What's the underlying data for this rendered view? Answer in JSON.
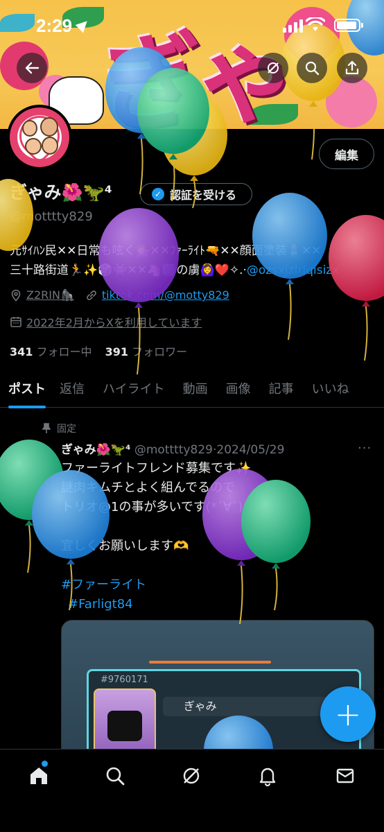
{
  "status_bar": {
    "time": "2:29"
  },
  "profile": {
    "banner_text": "ぎゃみ",
    "display_name": "ぎゃみ🌺🦖⁴",
    "handle": "@motttty829",
    "edit_label": "編集",
    "verify_label": "認証を受ける",
    "bio_line1": "元ｻｲﾊﾝ民✕✕日常も呟く💁‍♀️✕✕ﾌｧｰﾗｲﾄ🔫✕✕顔面塗装💄✕✕",
    "bio_line2_prefix": "三十路街道🏃✨🎲👾✕✕🦄🎆の虜🙆‍♀️❤️✧.·",
    "bio_line2_link": "@ozsxjzlrlqisizx",
    "location": "Z2RIN🦍",
    "website": "tiktok.com/@motty829",
    "joined": "2022年2月からXを利用しています",
    "following_count": "341",
    "following_label": "フォロー中",
    "followers_count": "391",
    "followers_label": "フォロワー"
  },
  "tabs": [
    "ポスト",
    "返信",
    "ハイライト",
    "動画",
    "画像",
    "記事",
    "いいね"
  ],
  "pinned_post": {
    "pinned_label": "固定",
    "author_name": "ぎゃみ🌺🦖⁴",
    "author_handle": "@motttty829",
    "separator": "·",
    "date": "2024/05/29",
    "more": "···",
    "lines": [
      "ファーライトフレンド募集です✨",
      "謎肉キムチとよく組んでるので",
      "トリオ@1の事が多いです(*´∀`)",
      "",
      "宜しくお願いします🫶"
    ],
    "hashtag1": "#ファーライト",
    "hashtag2": "#Farligt84",
    "media": {
      "id_text": "#9760171",
      "username": "ぎゃみ"
    }
  },
  "fab_label": "+",
  "colors": {
    "accent": "#1d9bf0",
    "background": "#000000",
    "text": "#e7e9ea",
    "muted": "#71767b",
    "banner_pink": "#d9317a"
  },
  "icons": {
    "back": "arrow-left-icon",
    "grok": "grok-icon",
    "search": "search-icon",
    "share": "share-icon",
    "location": "map-pin-icon",
    "link": "link-icon",
    "calendar": "calendar-icon",
    "home": "home-icon",
    "explore": "search-icon",
    "grok_nav": "grok-icon",
    "notifications": "bell-icon",
    "messages": "mail-icon"
  }
}
